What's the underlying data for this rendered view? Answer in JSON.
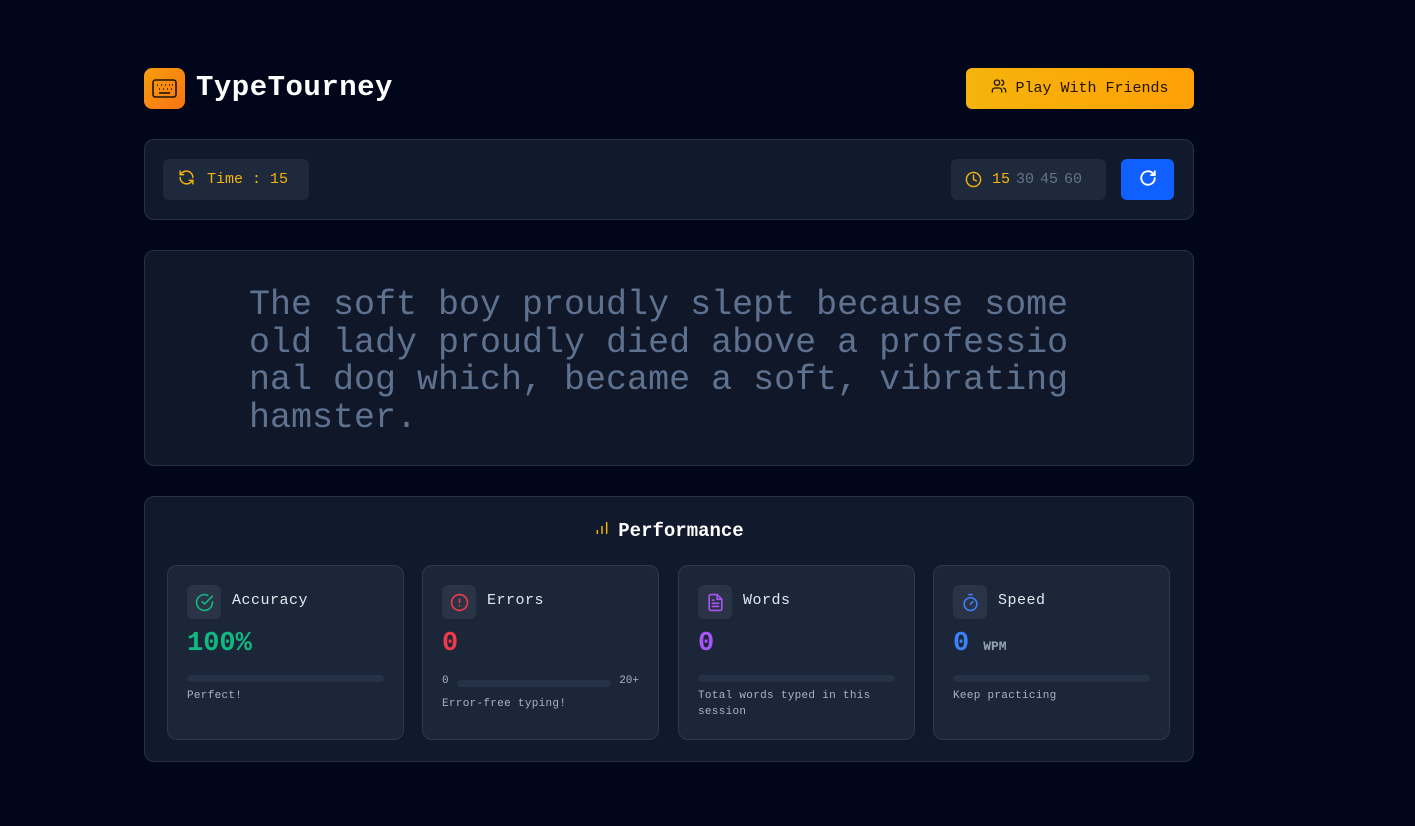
{
  "header": {
    "brand": "TypeTourney",
    "logo_icon": "keyboard-icon",
    "friends_button": "Play With Friends",
    "friends_icon": "users-icon"
  },
  "controls": {
    "time_label": "Time : 15",
    "time_icon": "refresh-icon",
    "duration_icon": "clock-icon",
    "durations": [
      "15",
      "30",
      "45",
      "60"
    ],
    "selected_duration": "15",
    "restart_icon": "restart-icon"
  },
  "passage": {
    "text": "The soft boy proudly slept because some old lady proudly died above a professional dog which, became a soft, vibrating hamster."
  },
  "performance": {
    "title": "Performance",
    "title_icon": "bar-chart-icon",
    "cards": {
      "accuracy": {
        "label": "Accuracy",
        "value": "100%",
        "note": "Perfect!",
        "color": "#10b981",
        "icon": "check-circle-icon",
        "fill_fraction": 0
      },
      "errors": {
        "label": "Errors",
        "value": "0",
        "scale_min": "0",
        "scale_max": "20+",
        "note": "Error-free typing!",
        "color": "#ef3a4a",
        "icon": "alert-circle-icon",
        "fill_fraction": 0
      },
      "words": {
        "label": "Words",
        "value": "0",
        "note": "Total words typed in this session",
        "color": "#a855f7",
        "icon": "file-text-icon",
        "fill_fraction": 0
      },
      "speed": {
        "label": "Speed",
        "value": "0",
        "unit": "WPM",
        "note": "Keep practicing",
        "color": "#3b82f6",
        "icon": "timer-icon",
        "fill_fraction": 0
      }
    }
  },
  "colors": {
    "accent": "#f5b40b",
    "primary": "#1060ff",
    "background": "#02061a"
  }
}
